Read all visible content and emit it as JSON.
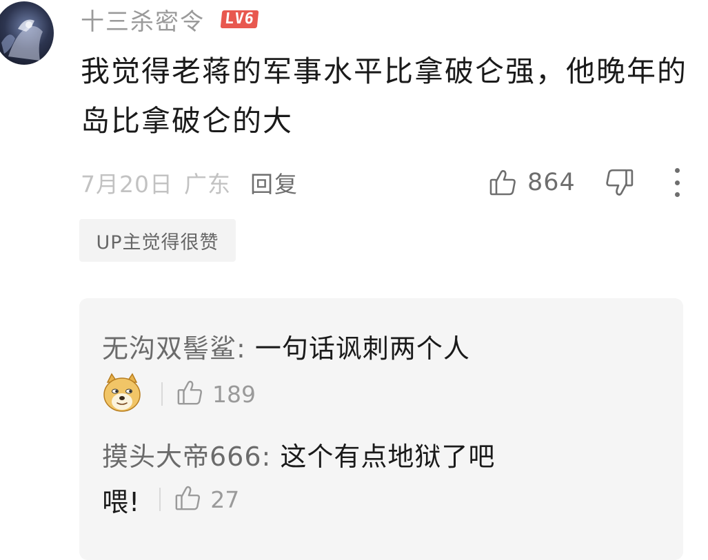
{
  "comment": {
    "username": "十三杀密令",
    "level": "LV6",
    "text": "我觉得老蒋的军事水平比拿破仑强，他晚年的岛比拿破仑的大",
    "date": "7月20日",
    "location": "广东",
    "reply_label": "回复",
    "like_count": "864",
    "tag": "UP主觉得很赞"
  },
  "replies": [
    {
      "user": "无沟双髻鲨",
      "separator": ": ",
      "text": "一句话讽刺两个人",
      "continuation": "",
      "like_count": "189",
      "has_emoji": true,
      "emoji_name": "doge-emoji"
    },
    {
      "user": "摸头大帝666",
      "separator": ": ",
      "text": "这个有点地狱了吧",
      "continuation": "喂!",
      "like_count": "27",
      "has_emoji": false
    }
  ],
  "colors": {
    "username": "#9a9a9a",
    "level_badge": "#e8584f",
    "panel_bg": "#f5f5f5",
    "tag_bg": "#f3f3f3",
    "muted": "#c2c2c2"
  },
  "icons": {
    "like": "thumbs-up-icon",
    "dislike": "thumbs-down-icon",
    "more": "more-vertical-icon"
  }
}
